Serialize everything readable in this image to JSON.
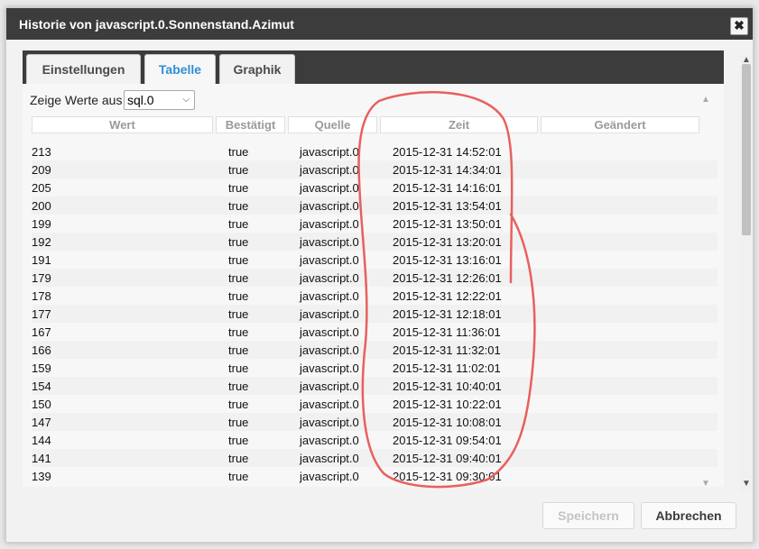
{
  "dialog": {
    "title": "Historie von javascript.0.Sonnenstand.Azimut",
    "close_label": "✖"
  },
  "tabs": [
    {
      "label": "Einstellungen",
      "active": false
    },
    {
      "label": "Tabelle",
      "active": true
    },
    {
      "label": "Graphik",
      "active": false
    }
  ],
  "filter": {
    "label": "Zeige Werte aus",
    "selected": "sql.0"
  },
  "table": {
    "columns": [
      "Wert",
      "Bestätigt",
      "Quelle",
      "Zeit",
      "Geändert"
    ],
    "rows": [
      [
        "213",
        "true",
        "javascript.0",
        "2015-12-31 14:52:01"
      ],
      [
        "209",
        "true",
        "javascript.0",
        "2015-12-31 14:34:01"
      ],
      [
        "205",
        "true",
        "javascript.0",
        "2015-12-31 14:16:01"
      ],
      [
        "200",
        "true",
        "javascript.0",
        "2015-12-31 13:54:01"
      ],
      [
        "199",
        "true",
        "javascript.0",
        "2015-12-31 13:50:01"
      ],
      [
        "192",
        "true",
        "javascript.0",
        "2015-12-31 13:20:01"
      ],
      [
        "191",
        "true",
        "javascript.0",
        "2015-12-31 13:16:01"
      ],
      [
        "179",
        "true",
        "javascript.0",
        "2015-12-31 12:26:01"
      ],
      [
        "178",
        "true",
        "javascript.0",
        "2015-12-31 12:22:01"
      ],
      [
        "177",
        "true",
        "javascript.0",
        "2015-12-31 12:18:01"
      ],
      [
        "167",
        "true",
        "javascript.0",
        "2015-12-31 11:36:01"
      ],
      [
        "166",
        "true",
        "javascript.0",
        "2015-12-31 11:32:01"
      ],
      [
        "159",
        "true",
        "javascript.0",
        "2015-12-31 11:02:01"
      ],
      [
        "154",
        "true",
        "javascript.0",
        "2015-12-31 10:40:01"
      ],
      [
        "150",
        "true",
        "javascript.0",
        "2015-12-31 10:22:01"
      ],
      [
        "147",
        "true",
        "javascript.0",
        "2015-12-31 10:08:01"
      ],
      [
        "144",
        "true",
        "javascript.0",
        "2015-12-31 09:54:01"
      ],
      [
        "141",
        "true",
        "javascript.0",
        "2015-12-31 09:40:01"
      ],
      [
        "139",
        "true",
        "javascript.0",
        "2015-12-31 09:30:01"
      ]
    ]
  },
  "buttons": {
    "save": "Speichern",
    "cancel": "Abbrechen"
  },
  "colors": {
    "titlebar": "#3c3c3c",
    "active_tab": "#2f8ed4",
    "annotation": "#e8605f"
  }
}
